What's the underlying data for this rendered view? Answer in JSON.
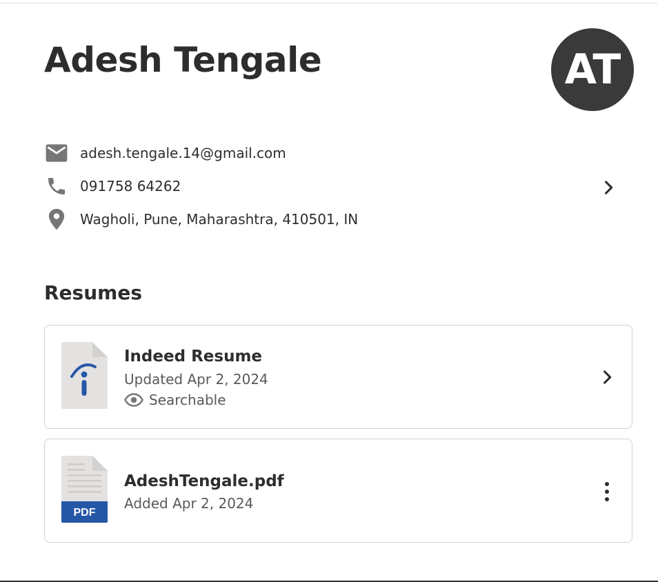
{
  "profile": {
    "name": "Adesh Tengale",
    "initials": "AT"
  },
  "contact": {
    "email": "adesh.tengale.14@gmail.com",
    "phone": "091758 64262",
    "location": "Wagholi, Pune, Maharashtra, 410501, IN"
  },
  "resumes": {
    "section_title": "Resumes",
    "items": [
      {
        "title": "Indeed Resume",
        "date": "Updated Apr 2, 2024",
        "visibility": "Searchable",
        "icon": "indeed-resume-icon"
      },
      {
        "title": "AdeshTengale.pdf",
        "date": "Added Apr 2, 2024",
        "badge": "PDF",
        "icon": "pdf-file-icon"
      }
    ]
  },
  "colors": {
    "text": "#2d2d2d",
    "muted": "#595959",
    "icon": "#767676",
    "avatar_bg": "#3a3a3a",
    "indeed_blue": "#2557a7",
    "card_border": "#d4d2d0"
  }
}
